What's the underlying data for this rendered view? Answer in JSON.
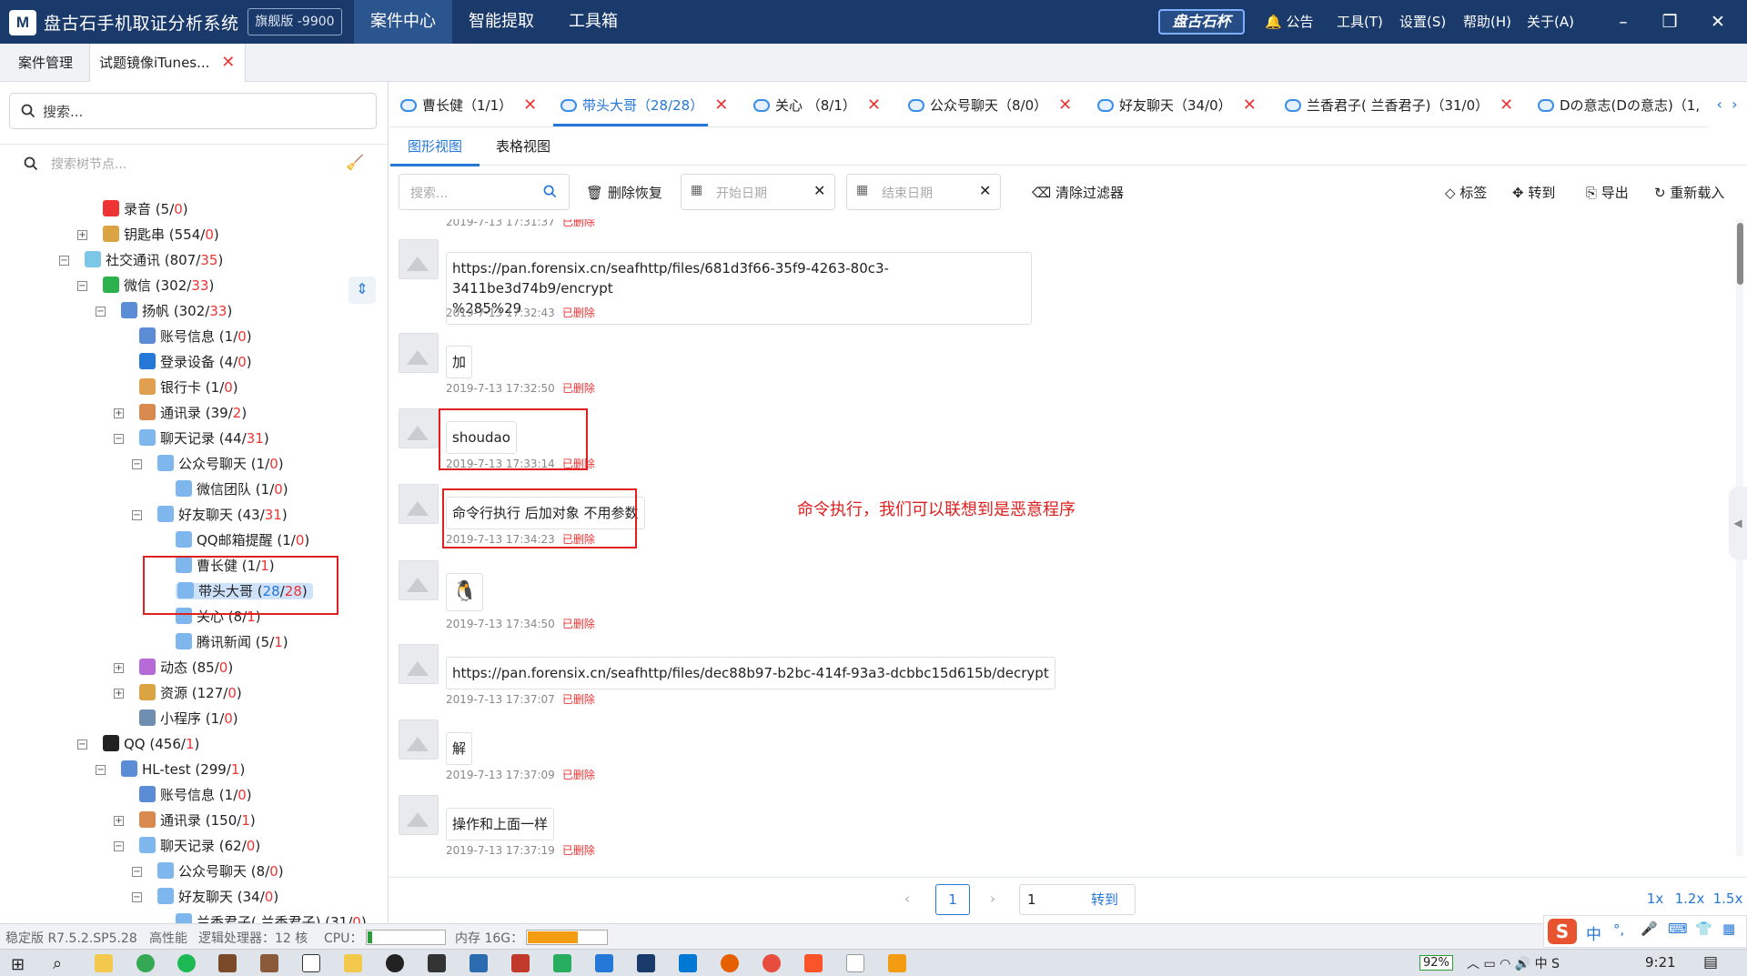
{
  "app": {
    "logo_text": "M",
    "title": "盘古石手机取证分析系统",
    "edition": "旗舰版 -9900",
    "brand": "盘古石杯"
  },
  "main_menu": [
    "案件中心",
    "智能提取",
    "工具箱"
  ],
  "right_menu": {
    "notice": "公告",
    "tools": "工具(T)",
    "settings": "设置(S)",
    "help": "帮助(H)",
    "about": "关于(A)"
  },
  "window_controls": {
    "minimize": "–",
    "restore": "❐",
    "close": "✕"
  },
  "case_tabs": {
    "mgmt": "案件管理",
    "mirror": "试题镜像iTunes..."
  },
  "sidebar": {
    "search_placeholder": "搜索...",
    "tree_search_placeholder": "搜索树节点...",
    "nodes": [
      {
        "label": "录音",
        "total": "5",
        "red": "0"
      },
      {
        "label": "钥匙串",
        "total": "554",
        "red": "0"
      },
      {
        "label": "社交通讯",
        "total": "807",
        "red": "35"
      },
      {
        "label": "微信",
        "total": "302",
        "red": "33"
      },
      {
        "label": "扬帆",
        "total": "302",
        "red": "33"
      },
      {
        "label": "账号信息",
        "total": "1",
        "red": "0"
      },
      {
        "label": "登录设备",
        "total": "4",
        "red": "0"
      },
      {
        "label": "银行卡",
        "total": "1",
        "red": "0"
      },
      {
        "label": "通讯录",
        "total": "39",
        "red": "2"
      },
      {
        "label": "聊天记录",
        "total": "44",
        "red": "31"
      },
      {
        "label": "公众号聊天",
        "total": "1",
        "red": "0"
      },
      {
        "label": "微信团队",
        "total": "1",
        "red": "0"
      },
      {
        "label": "好友聊天",
        "total": "43",
        "red": "31"
      },
      {
        "label": "QQ邮箱提醒",
        "total": "1",
        "red": "0"
      },
      {
        "label": "曹长健",
        "total": "1",
        "red": "1"
      },
      {
        "label": "带头大哥",
        "total": "28",
        "red": "28"
      },
      {
        "label": "关心",
        "total": "8",
        "red": "1"
      },
      {
        "label": "腾讯新闻",
        "total": "5",
        "red": "1"
      },
      {
        "label": "动态",
        "total": "85",
        "red": "0"
      },
      {
        "label": "资源",
        "total": "127",
        "red": "0"
      },
      {
        "label": "小程序",
        "total": "1",
        "red": "0"
      },
      {
        "label": "QQ",
        "total": "456",
        "red": "1"
      },
      {
        "label": "HL-test",
        "total": "299",
        "red": "1"
      },
      {
        "label": "账号信息",
        "total": "1",
        "red": "0"
      },
      {
        "label": "通讯录",
        "total": "150",
        "red": "1"
      },
      {
        "label": "聊天记录",
        "total": "62",
        "red": "0"
      },
      {
        "label": "公众号聊天",
        "total": "8",
        "red": "0"
      },
      {
        "label": "好友聊天",
        "total": "34",
        "red": "0"
      },
      {
        "label": "兰香君子( 兰香君子)",
        "total": "31",
        "red": "0"
      }
    ]
  },
  "chat_tabs": [
    {
      "label": "曹长健（1/1）"
    },
    {
      "label": "带头大哥（28/28）"
    },
    {
      "label": "关心 （8/1）"
    },
    {
      "label": "公众号聊天（8/0）"
    },
    {
      "label": "好友聊天（34/0）"
    },
    {
      "label": "兰香君子( 兰香君子)（31/0）"
    },
    {
      "label": "Dの意志(Dの意志)（1,"
    }
  ],
  "view_tabs": {
    "graph": "图形视图",
    "table": "表格视图"
  },
  "toolbar": {
    "search_placeholder": "搜索...",
    "delete_restore": "删除恢复",
    "start_date": "开始日期",
    "end_date": "结束日期",
    "clear_filter": "清除过滤器",
    "tag": "标签",
    "goto": "转到",
    "export": "导出",
    "reload": "重新载入"
  },
  "messages": {
    "partial_top": "2019-7-13 17:31:37",
    "deleted_label": "已删除",
    "items": [
      {
        "text1": "https://pan.forensix.cn/seafhttp/files/681d3f66-35f9-4263-80c3-3411be3d74b9/encrypt",
        "text2": "%285%29",
        "time": "2019-7-13 17:32:43"
      },
      {
        "text1": "加",
        "time": "2019-7-13 17:32:50"
      },
      {
        "text1": "shoudao",
        "time": "2019-7-13 17:33:14"
      },
      {
        "text1": "命令行执行 后加对象 不用参数",
        "time": "2019-7-13 17:34:23"
      },
      {
        "text1": "🐧",
        "time": "2019-7-13 17:34:50"
      },
      {
        "text1": "https://pan.forensix.cn/seafhttp/files/dec88b97-b2bc-414f-93a3-dcbbc15d615b/decrypt",
        "time": "2019-7-13 17:37:07"
      },
      {
        "text1": "解",
        "time": "2019-7-13 17:37:09"
      },
      {
        "text1": "操作和上面一样",
        "time": "2019-7-13 17:37:19"
      }
    ]
  },
  "annotation": "命令执行，我们可以联想到是恶意程序",
  "pagination": {
    "prev": "‹",
    "current": "1",
    "next": "›",
    "goto_value": "1",
    "goto_btn": "转到",
    "zooms": [
      "1x",
      "1.2x",
      "1.5x"
    ]
  },
  "status": {
    "version": "稳定版 R7.5.2.SP5.28",
    "perf": "高性能",
    "cores": "逻辑处理器：12 核",
    "cpu_label": "CPU：",
    "cpu_level": 0.06,
    "mem_label": "内存 16G：",
    "mem_level": 0.62
  },
  "ime": {
    "lang": "中",
    "punct": "°,"
  },
  "taskbar": {
    "battery": "92%",
    "time": "9:21"
  }
}
